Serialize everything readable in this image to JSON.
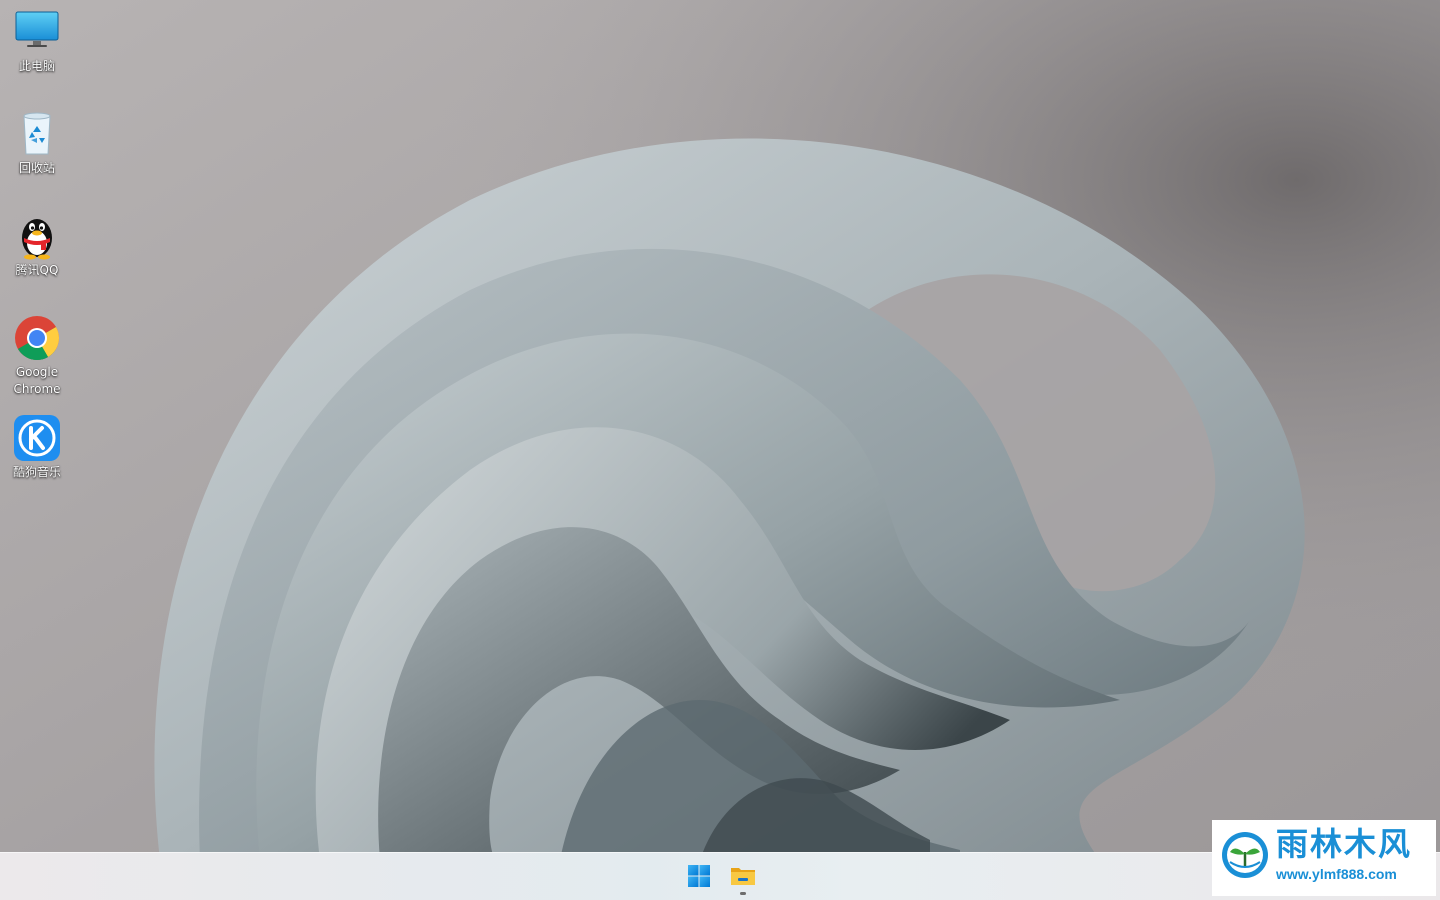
{
  "desktop_icons": [
    {
      "label": "此电脑",
      "icon": "computer-icon"
    },
    {
      "label": "回收站",
      "icon": "recycle-bin-icon"
    },
    {
      "label": "腾讯QQ",
      "icon": "qq-penguin-icon"
    },
    {
      "label": "Google Chrome",
      "icon": "chrome-icon"
    },
    {
      "label": "酷狗音乐",
      "icon": "kugou-icon"
    }
  ],
  "taskbar": {
    "items": [
      {
        "name": "Start",
        "icon": "windows-logo-icon"
      },
      {
        "name": "File Explorer",
        "icon": "folder-icon",
        "running": true
      }
    ]
  },
  "watermark": {
    "title": "雨林木风",
    "url": "www.ylmf888.com"
  },
  "colors": {
    "accent": "#1a8fd6",
    "windows_blue": "#0078d4",
    "folder_yellow": "#f4c430"
  }
}
